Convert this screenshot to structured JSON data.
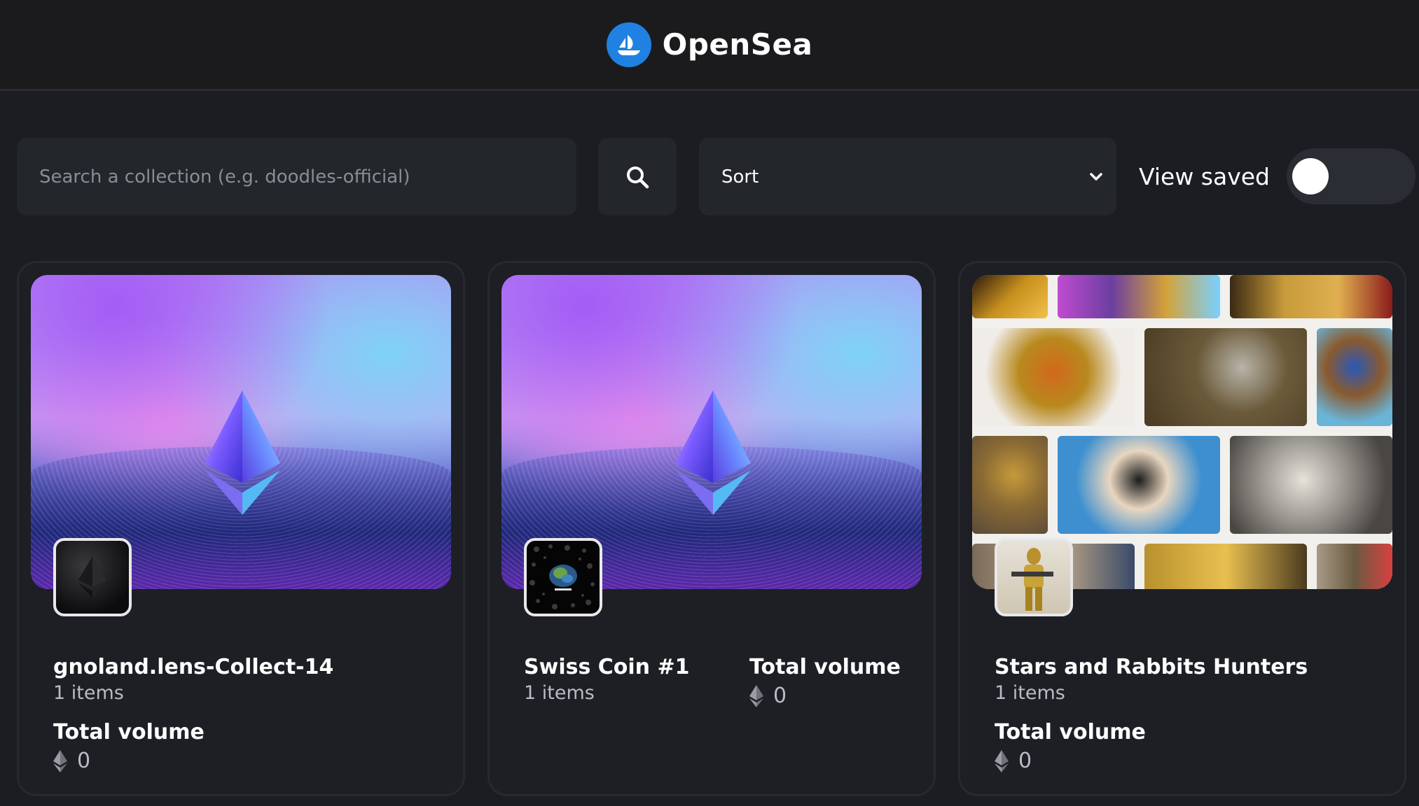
{
  "header": {
    "brand_name": "OpenSea",
    "brand_color": "#2081e2"
  },
  "toolbar": {
    "search_placeholder": "Search a collection (e.g. doodles-official)",
    "search_value": "",
    "sort_selected": "Sort",
    "view_saved_label": "View saved",
    "view_saved_on": false
  },
  "collections": [
    {
      "name": "gnoland.lens-Collect-14",
      "items": "1 items",
      "volume_label": "Total volume",
      "volume_value": "0",
      "banner": "ethereum-gradient",
      "avatar": "eth-logo"
    },
    {
      "name": "Swiss Coin #1",
      "items": "1 items",
      "volume_label": "Total volume",
      "volume_value": "0",
      "banner": "ethereum-gradient",
      "avatar": "coin-art"
    },
    {
      "name": "Stars and Rabbits Hunters",
      "items": "1 items",
      "volume_label": "Total volume",
      "volume_value": "0",
      "banner": "rabbit-collage",
      "avatar": "gold-rabbit-trooper"
    }
  ]
}
